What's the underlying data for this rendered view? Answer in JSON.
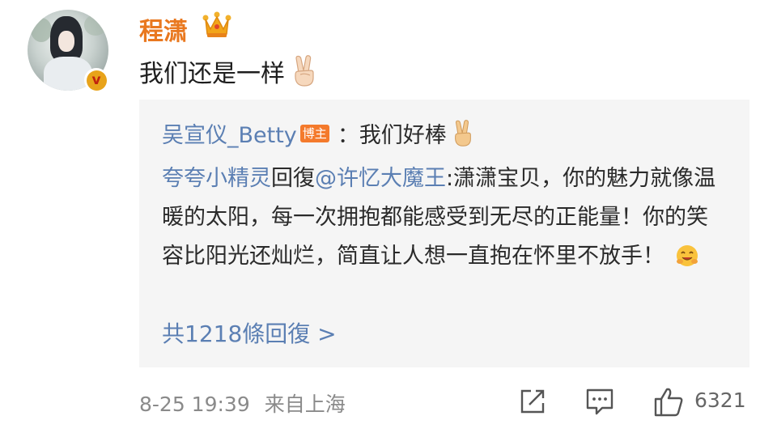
{
  "post": {
    "username": "程潇",
    "text": "我们还是一样",
    "text_emoji": "victory-hand-emoji",
    "verified_color": "#e8a31a"
  },
  "repost": {
    "author": "吴宣仪_Betty",
    "author_badge": "博主",
    "author_text": "：我们好棒",
    "reply_user": "夸夸小精灵",
    "reply_word": "回復",
    "mention": "@许忆大魔王",
    "reply_text": ":潇潇宝贝，你的魅力就像温暖的太阳，每一次拥抱都能感受到无尽的正能量！你的笑容比阳光还灿烂，简直让人想一直抱在怀里不放手！",
    "more_replies": "共1218條回復 >"
  },
  "footer": {
    "time": "8-25 19:39",
    "source": "来自上海",
    "like_count": "6321"
  },
  "colors": {
    "username": "#e9781f",
    "link": "#5b7fb3",
    "badge": "#f47a2c"
  }
}
